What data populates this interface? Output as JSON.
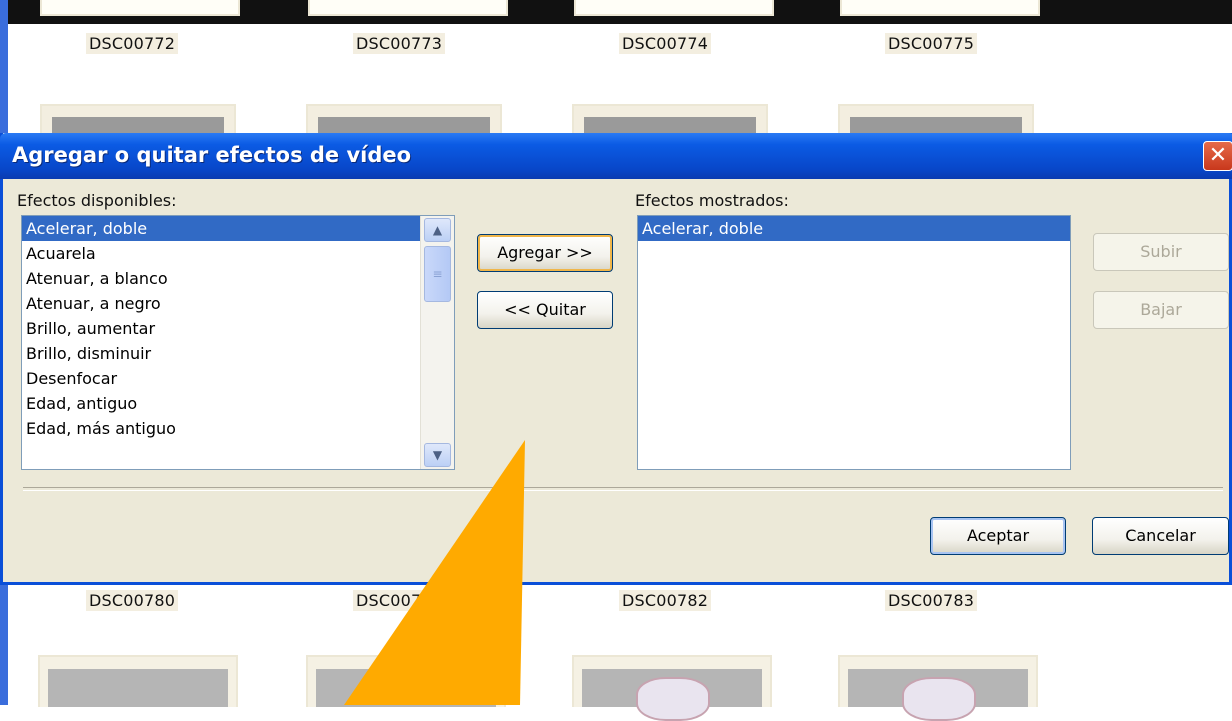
{
  "background": {
    "row1_labels": [
      "DSC00772",
      "DSC00773",
      "DSC00774",
      "DSC00775"
    ],
    "row2_labels": [
      "DSC00780",
      "DSC0078",
      "DSC00782",
      "DSC00783"
    ]
  },
  "dialog": {
    "title": "Agregar o quitar efectos de vídeo",
    "close_glyph": "✕",
    "available_label": "Efectos disponibles:",
    "shown_label": "Efectos mostrados:",
    "available_items": [
      "Acelerar, doble",
      "Acuarela",
      "Atenuar, a blanco",
      "Atenuar, a negro",
      "Brillo, aumentar",
      "Brillo, disminuir",
      "Desenfocar",
      "Edad, antiguo",
      "Edad, más antiguo"
    ],
    "shown_items": [
      "Acelerar, doble"
    ],
    "add_button": "Agregar >>",
    "remove_button": "<< Quitar",
    "up_button": "Subir",
    "down_button": "Bajar",
    "ok_button": "Aceptar",
    "cancel_button": "Cancelar"
  },
  "colors": {
    "titlebar": "#0846c8",
    "selection": "#316ac5",
    "annotation_arrow": "#ffaa00"
  }
}
